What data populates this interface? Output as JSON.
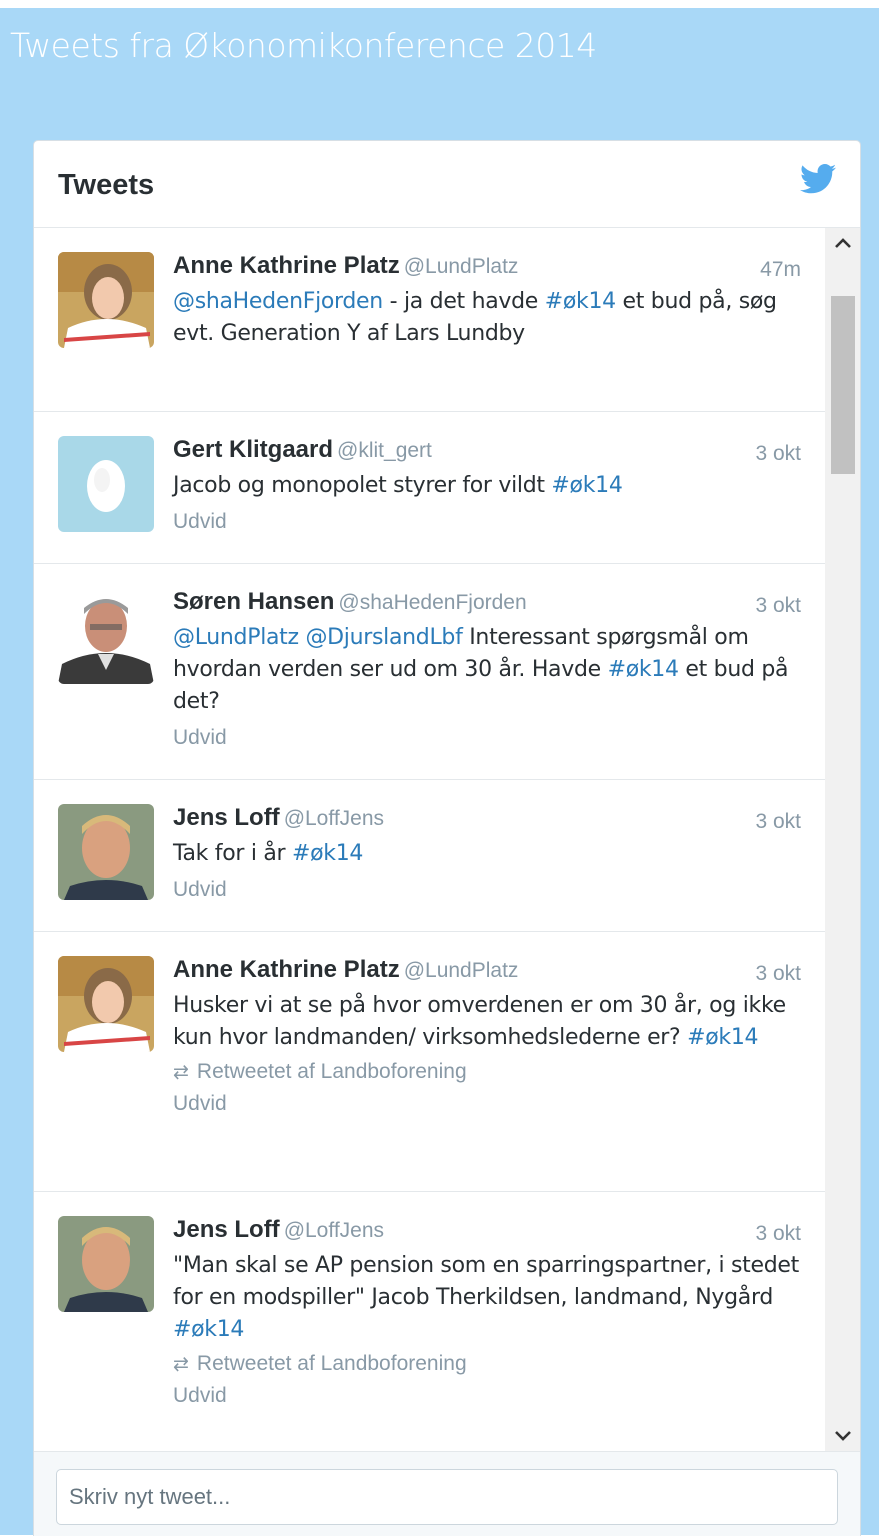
{
  "page": {
    "title": "Tweets fra Økonomikonference 2014"
  },
  "widget": {
    "title": "Tweets",
    "logo_icon": "twitter-bird-icon",
    "accent": "#55acee",
    "link_color": "#2b7bb9"
  },
  "tweets": [
    {
      "fullname": "Anne Kathrine Platz",
      "username": "@LundPlatz",
      "time": "47m",
      "text_parts": [
        {
          "t": "@shaHedenFjorden",
          "link": true
        },
        {
          "t": " - ja det havde ",
          "link": false
        },
        {
          "t": "#øk14",
          "link": true
        },
        {
          "t": "  et bud på, søg evt. Generation Y af Lars Lundby",
          "link": false
        }
      ],
      "retweet": null,
      "expand": null
    },
    {
      "fullname": "Gert Klitgaard",
      "username": "@klit_gert",
      "time": "3 okt",
      "text_parts": [
        {
          "t": "Jacob og monopolet styrer for vildt ",
          "link": false
        },
        {
          "t": "#øk14",
          "link": true
        }
      ],
      "retweet": null,
      "expand": "Udvid"
    },
    {
      "fullname": "Søren Hansen",
      "username": "@shaHedenFjorden",
      "time": "3 okt",
      "text_parts": [
        {
          "t": "@LundPlatz",
          "link": true
        },
        {
          "t": " ",
          "link": false
        },
        {
          "t": "@DjurslandLbf",
          "link": true
        },
        {
          "t": " Interessant spørgsmål om hvordan verden ser ud om 30 år. Havde ",
          "link": false
        },
        {
          "t": "#øk14",
          "link": true
        },
        {
          "t": " et bud på det?",
          "link": false
        }
      ],
      "retweet": null,
      "expand": "Udvid"
    },
    {
      "fullname": "Jens Loff",
      "username": "@LoffJens",
      "time": "3 okt",
      "text_parts": [
        {
          "t": "Tak for i år ",
          "link": false
        },
        {
          "t": "#øk14",
          "link": true
        }
      ],
      "retweet": null,
      "expand": "Udvid"
    },
    {
      "fullname": "Anne Kathrine Platz",
      "username": "@LundPlatz",
      "time": "3 okt",
      "text_parts": [
        {
          "t": "Husker vi at se på hvor omverdenen er om 30 år, og ikke kun hvor landmanden/ virksomhedslederne er? ",
          "link": false
        },
        {
          "t": "#øk14",
          "link": true
        }
      ],
      "retweet": "Retweetet af Landboforening",
      "expand": "Udvid"
    },
    {
      "fullname": "Jens Loff",
      "username": "@LoffJens",
      "time": "3 okt",
      "text_parts": [
        {
          "t": "\"Man skal se AP pension som en sparringspartner, i stedet for en modspiller\" Jacob Therkildsen, landmand, Nygård ",
          "link": false
        },
        {
          "t": "#øk14",
          "link": true
        }
      ],
      "retweet": "Retweetet af Landboforening",
      "expand": "Udvid"
    }
  ],
  "compose": {
    "placeholder": "Skriv nyt tweet..."
  }
}
